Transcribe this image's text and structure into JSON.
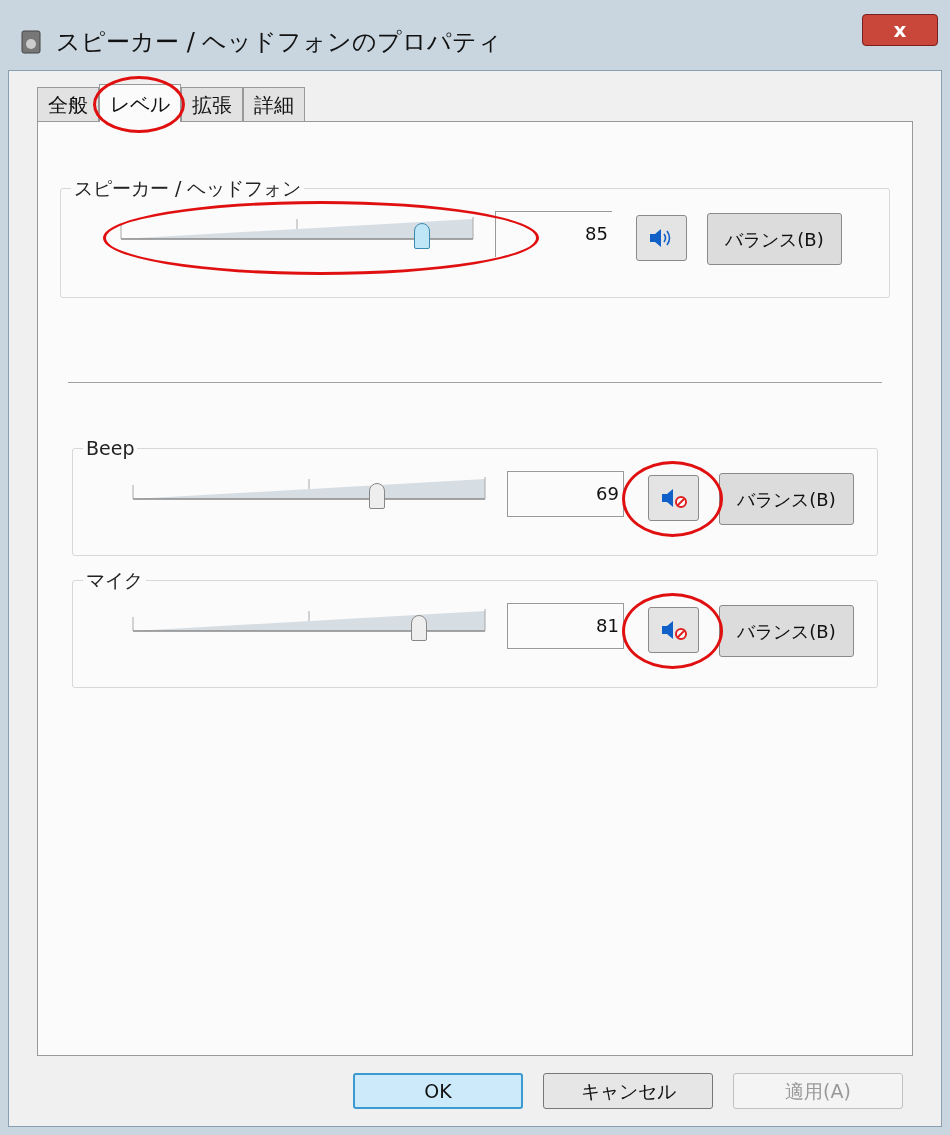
{
  "window": {
    "title": "スピーカー / ヘッドフォンのプロパティ",
    "close": "x"
  },
  "tabs": [
    {
      "label": "全般",
      "selected": false,
      "circled": false
    },
    {
      "label": "レベル",
      "selected": true,
      "circled": true
    },
    {
      "label": "拡張",
      "selected": false,
      "circled": false
    },
    {
      "label": "詳細",
      "selected": false,
      "circled": false
    }
  ],
  "main_channel": {
    "name": "スピーカー / ヘッドフォン",
    "level": 0.85,
    "reading": "85",
    "muted": false,
    "focused": true,
    "slider_circled": true,
    "mute_circled": false,
    "balance": "バランス(B)"
  },
  "channels": [
    {
      "name": "Beep",
      "level": 0.69,
      "reading": "69",
      "muted": true,
      "focused": false,
      "slider_circled": false,
      "mute_circled": true,
      "balance": "バランス(B)"
    },
    {
      "name": "マイク",
      "level": 0.81,
      "reading": "81",
      "muted": true,
      "focused": false,
      "slider_circled": false,
      "mute_circled": true,
      "balance": "バランス(B)"
    }
  ],
  "buttons": [
    {
      "label": "OK",
      "default": true,
      "disabled": false
    },
    {
      "label": "キャンセル",
      "default": false,
      "disabled": false
    },
    {
      "label": "適用(A)",
      "default": false,
      "disabled": true
    }
  ]
}
